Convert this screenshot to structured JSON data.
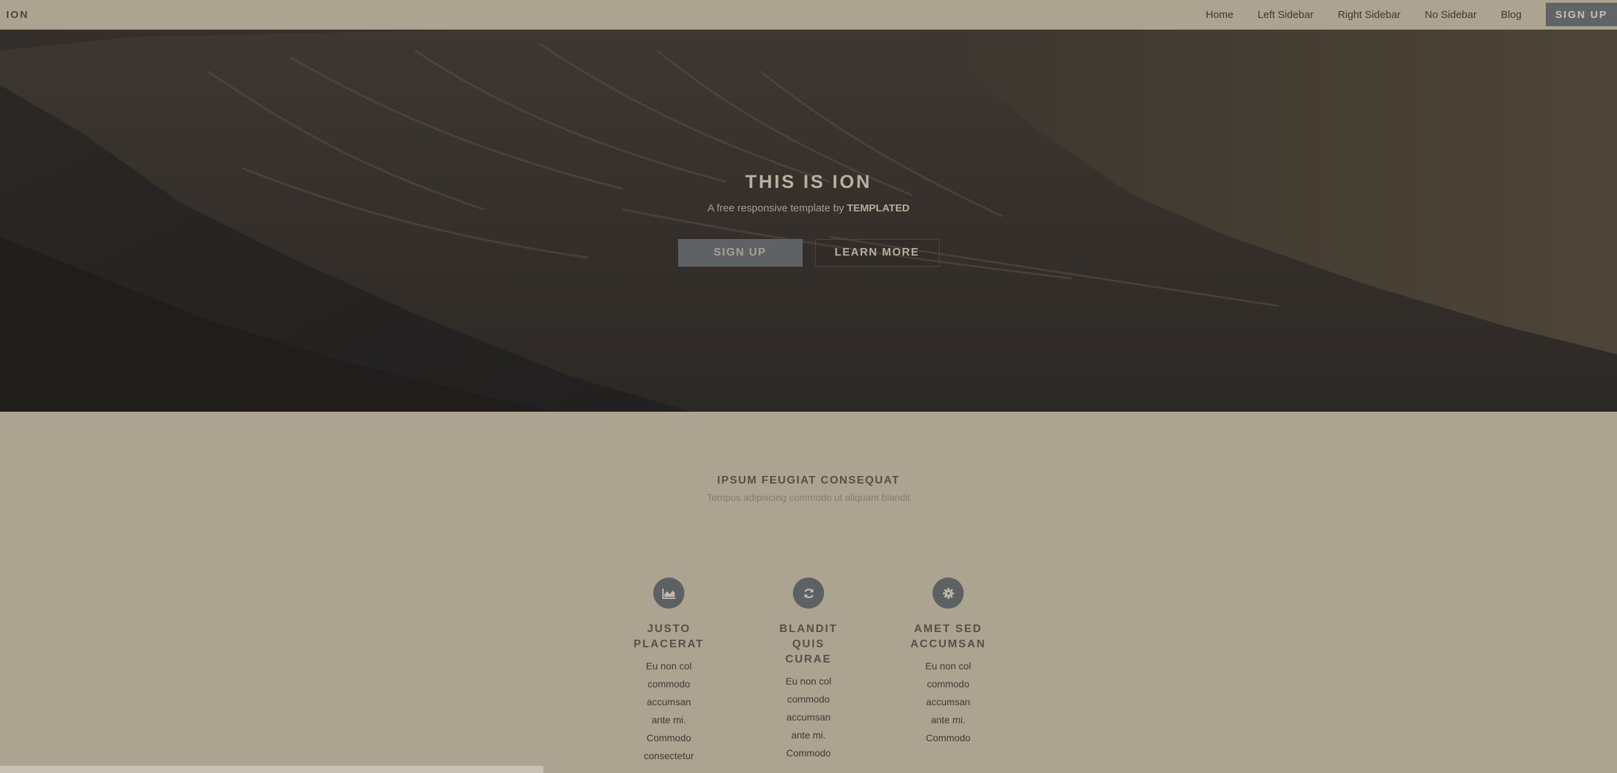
{
  "header": {
    "logo": "ION",
    "nav": [
      "Home",
      "Left Sidebar",
      "Right Sidebar",
      "No Sidebar",
      "Blog"
    ],
    "signup_label": "SIGN UP"
  },
  "hero": {
    "title": "THIS IS ION",
    "subtitle_prefix": "A free responsive template by ",
    "subtitle_brand": "TEMPLATED",
    "primary_button": "SIGN UP",
    "secondary_button": "LEARN MORE"
  },
  "section": {
    "title": "IPSUM FEUGIAT CONSEQUAT",
    "subtitle": "Tempus adipiscing commodo ut aliquam blandit"
  },
  "features": [
    {
      "icon": "area-chart-icon",
      "title": "JUSTO PLACERAT",
      "text": "Eu non col commodo accumsan ante mi. Commodo consectetur"
    },
    {
      "icon": "refresh-icon",
      "title": "BLANDIT QUIS CURAE",
      "text": "Eu non col commodo accumsan ante mi. Commodo"
    },
    {
      "icon": "gear-icon",
      "title": "AMET SED ACCUMSAN",
      "text": "Eu non col commodo accumsan ante mi. Commodo"
    }
  ],
  "colors": {
    "background": "#aca391",
    "accent": "#5e6265",
    "text_dark": "#3e3a35"
  }
}
